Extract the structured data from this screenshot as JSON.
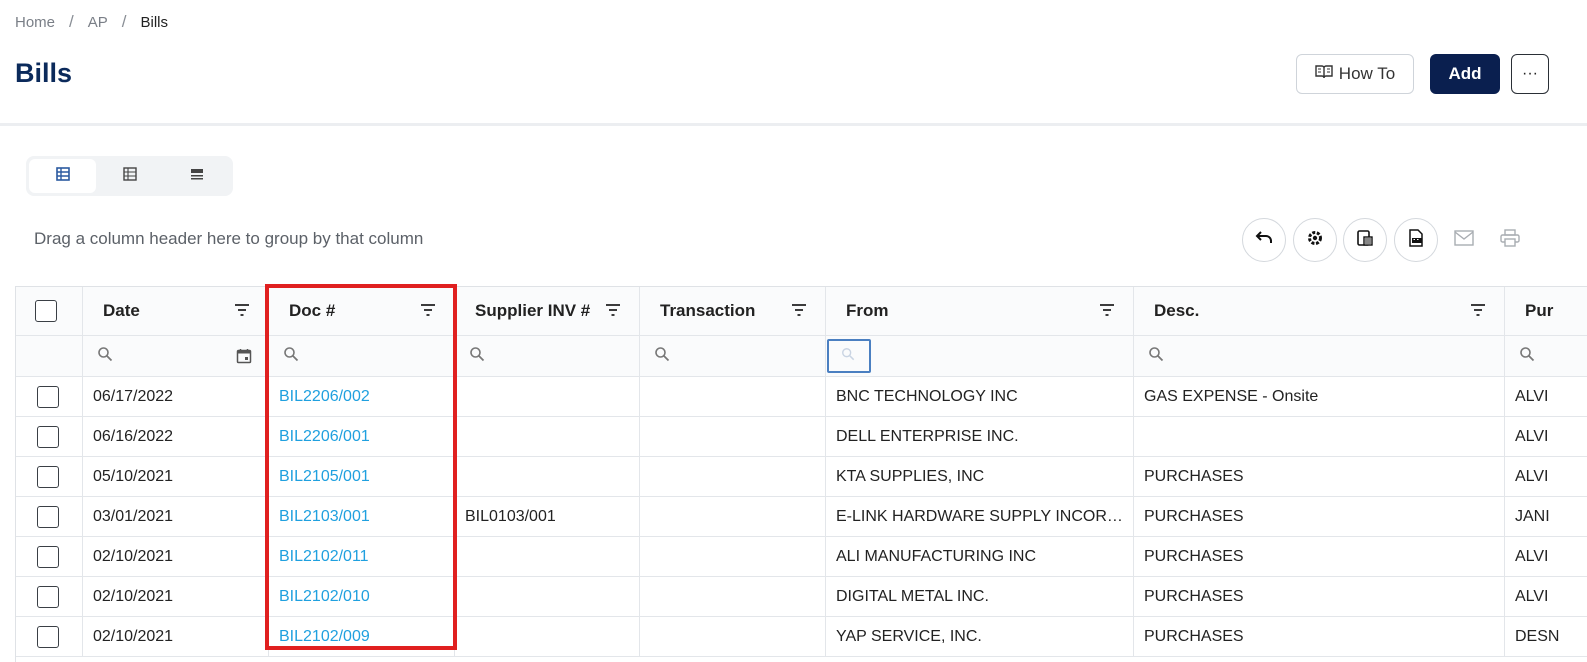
{
  "breadcrumb": {
    "home": "Home",
    "ap": "AP",
    "current": "Bills",
    "sep": "/"
  },
  "page": {
    "title": "Bills"
  },
  "header_actions": {
    "howto_label": "How To",
    "add_label": "Add",
    "more_label": "···"
  },
  "grid": {
    "group_hint": "Drag a column header here to group by that column",
    "columns": {
      "date": "Date",
      "doc": "Doc #",
      "supplier_inv": "Supplier INV #",
      "transaction": "Transaction",
      "from": "From",
      "desc": "Desc.",
      "pur": "Pur"
    },
    "rows": [
      {
        "date": "06/17/2022",
        "doc": "BIL2206/002",
        "supplier_inv": "",
        "transaction": "",
        "from": "BNC TECHNOLOGY INC",
        "desc": "GAS EXPENSE - Onsite",
        "pur": "ALVI"
      },
      {
        "date": "06/16/2022",
        "doc": "BIL2206/001",
        "supplier_inv": "",
        "transaction": "",
        "from": "DELL ENTERPRISE INC.",
        "desc": "",
        "pur": "ALVI"
      },
      {
        "date": "05/10/2021",
        "doc": "BIL2105/001",
        "supplier_inv": "",
        "transaction": "",
        "from": "KTA SUPPLIES, INC",
        "desc": "PURCHASES",
        "pur": "ALVI"
      },
      {
        "date": "03/01/2021",
        "doc": "BIL2103/001",
        "supplier_inv": "BIL0103/001",
        "transaction": "",
        "from": "E-LINK HARDWARE SUPPLY INCORPO...",
        "desc": "PURCHASES",
        "pur": "JANI"
      },
      {
        "date": "02/10/2021",
        "doc": "BIL2102/011",
        "supplier_inv": "",
        "transaction": "",
        "from": "ALI MANUFACTURING INC",
        "desc": "PURCHASES",
        "pur": "ALVI"
      },
      {
        "date": "02/10/2021",
        "doc": "BIL2102/010",
        "supplier_inv": "",
        "transaction": "",
        "from": "DIGITAL METAL INC.",
        "desc": "PURCHASES",
        "pur": "ALVI"
      },
      {
        "date": "02/10/2021",
        "doc": "BIL2102/009",
        "supplier_inv": "",
        "transaction": "",
        "from": "YAP SERVICE, INC.",
        "desc": "PURCHASES",
        "pur": "DESN"
      }
    ]
  },
  "colors": {
    "title": "#0b2a5b",
    "add_button": "#0a1f4f",
    "link": "#1fa0df",
    "highlight": "#e02020"
  },
  "icons": {
    "howto": "book-icon",
    "view_buttons": [
      "grid-view-icon",
      "list-view-icon",
      "compact-view-icon"
    ],
    "toolbar": [
      "undo-icon",
      "gear-icon",
      "column-chooser-icon",
      "export-pdf-icon",
      "mail-icon",
      "print-icon"
    ],
    "filter": "filter-lines-icon",
    "search": "search-icon",
    "calendar": "calendar-icon"
  }
}
